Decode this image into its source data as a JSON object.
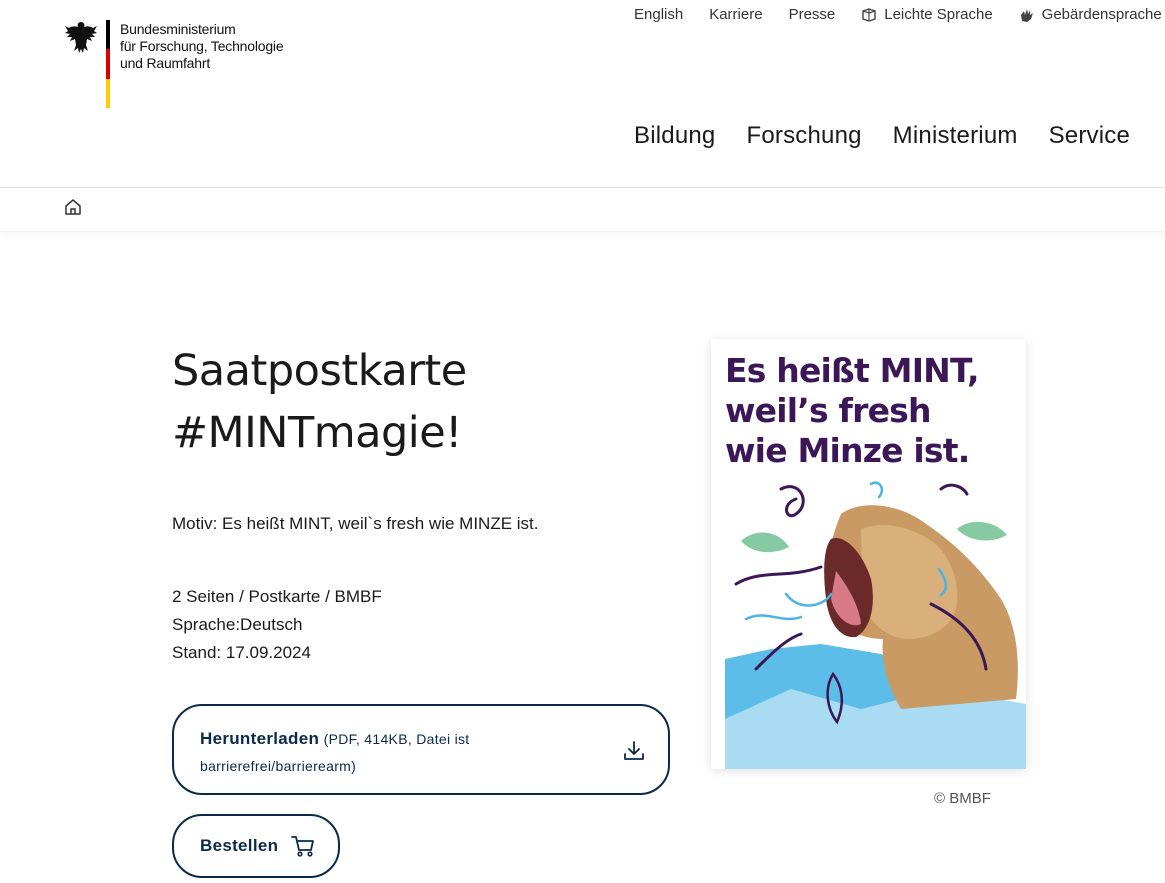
{
  "header": {
    "ministry_lines": [
      "Bundesministerium",
      "für Forschung, Technologie",
      "und Raumfahrt"
    ],
    "meta_nav": [
      {
        "label": "English",
        "icon": null
      },
      {
        "label": "Karriere",
        "icon": null
      },
      {
        "label": "Presse",
        "icon": null
      },
      {
        "label": "Leichte Sprache",
        "icon": "easy-language-icon"
      },
      {
        "label": "Gebärdensprache",
        "icon": "sign-language-icon"
      }
    ],
    "main_nav": [
      "Bildung",
      "Forschung",
      "Ministerium",
      "Service"
    ],
    "flag_colors": [
      "#000000",
      "#dd0000",
      "#ffcc00"
    ]
  },
  "breadcrumb": {
    "home_icon": "home-icon"
  },
  "content": {
    "title_line1": "Saatpostkarte",
    "title_line2": "#MINTmagie!",
    "motive": "Motiv: Es heißt MINT, weil`s fresh wie MINZE ist.",
    "details": [
      "2 Seiten / Postkarte / BMBF",
      "Sprache:Deutsch",
      "Stand: 17.09.2024"
    ],
    "download": {
      "label": "Herunterladen",
      "info_line1": "(PDF, 414KB, Datei ist",
      "info_line2": "barrierefrei/barrierearm)",
      "icon": "download-icon"
    },
    "order": {
      "label": "Bestellen",
      "icon": "cart-icon"
    }
  },
  "postcard": {
    "lines": [
      "Es heißt MINT,",
      "weil’s fresh",
      "wie Minze ist."
    ],
    "copyright": "© BMBF",
    "colors": {
      "text": "#3b1757",
      "sky": "#9fd6f2",
      "accent": "#4ab3e6",
      "leaf": "#86c9a3"
    }
  }
}
